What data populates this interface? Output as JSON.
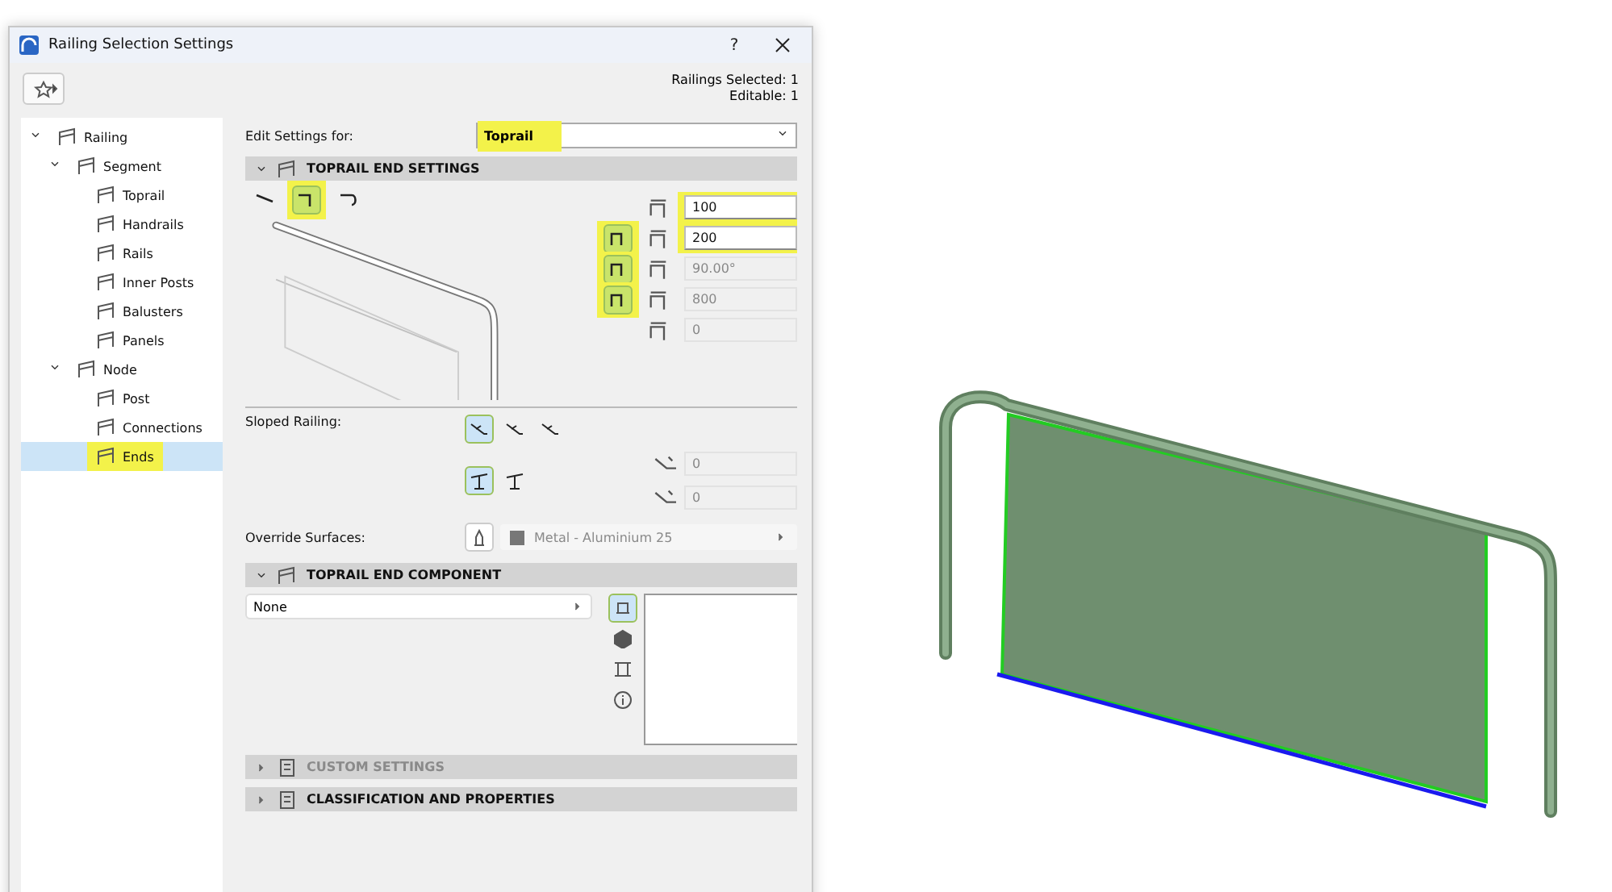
{
  "window": {
    "title": "Railing Selection Settings",
    "help": "?"
  },
  "header": {
    "selected_count": "Railings Selected: 1",
    "editable_count": "Editable: 1"
  },
  "tree": [
    {
      "label": "Railing",
      "expanded": true,
      "selected": false,
      "highlighted": false,
      "children": [
        {
          "label": "Segment",
          "expanded": true,
          "selected": false,
          "highlighted": false,
          "children": [
            {
              "label": "Toprail",
              "selected": false,
              "highlighted": false
            },
            {
              "label": "Handrails",
              "selected": false,
              "highlighted": false
            },
            {
              "label": "Rails",
              "selected": false,
              "highlighted": false
            },
            {
              "label": "Inner Posts",
              "selected": false,
              "highlighted": false
            },
            {
              "label": "Balusters",
              "selected": false,
              "highlighted": false
            },
            {
              "label": "Panels",
              "selected": false,
              "highlighted": false
            }
          ]
        },
        {
          "label": "Node",
          "expanded": true,
          "selected": false,
          "highlighted": false,
          "children": [
            {
              "label": "Post",
              "selected": false,
              "highlighted": false
            },
            {
              "label": "Connections",
              "selected": false,
              "highlighted": false
            },
            {
              "label": "Ends",
              "selected": true,
              "highlighted": true
            }
          ]
        }
      ]
    }
  ],
  "edit_settings": {
    "label": "Edit Settings for:",
    "value": "Toprail",
    "highlighted": true
  },
  "end_settings": {
    "title": "TOPRAIL END SETTINGS",
    "expanded": true,
    "end_types": [
      {
        "selected": false,
        "highlighted": false
      },
      {
        "selected": true,
        "highlighted": true
      },
      {
        "selected": false,
        "highlighted": false
      }
    ],
    "fields": [
      {
        "value": "100",
        "disabled": false,
        "highlighted": true
      },
      {
        "value": "200",
        "disabled": false,
        "highlighted": true,
        "option": {
          "selected": true,
          "highlighted": true
        }
      },
      {
        "value": "90.00°",
        "disabled": true,
        "highlighted": false,
        "option": {
          "selected": true,
          "highlighted": true
        }
      },
      {
        "value": "800",
        "disabled": true,
        "highlighted": false,
        "option": {
          "selected": true,
          "highlighted": true
        }
      },
      {
        "value": "0",
        "disabled": true,
        "highlighted": false
      }
    ]
  },
  "sloped": {
    "label": "Sloped Railing:",
    "row_1": [
      {
        "selected": true
      },
      {
        "selected": false
      },
      {
        "selected": false
      }
    ],
    "row_2": [
      {
        "selected": true
      },
      {
        "selected": false
      }
    ],
    "fields": [
      {
        "value": "0",
        "disabled": true
      },
      {
        "value": "0",
        "disabled": true
      }
    ]
  },
  "override": {
    "label": "Override Surfaces:",
    "material": "Metal - Aluminium 25",
    "disabled": true
  },
  "component": {
    "title": "TOPRAIL END COMPONENT",
    "expanded": true,
    "value": "None",
    "view_buttons": [
      {
        "selected": true
      },
      {
        "selected": false
      },
      {
        "selected": false
      },
      {
        "selected": false
      }
    ]
  },
  "collapsed_sections": [
    {
      "title": "CUSTOM SETTINGS",
      "expanded": false,
      "disabled": true
    },
    {
      "title": "CLASSIFICATION AND PROPERTIES",
      "expanded": false,
      "disabled": false
    }
  ]
}
